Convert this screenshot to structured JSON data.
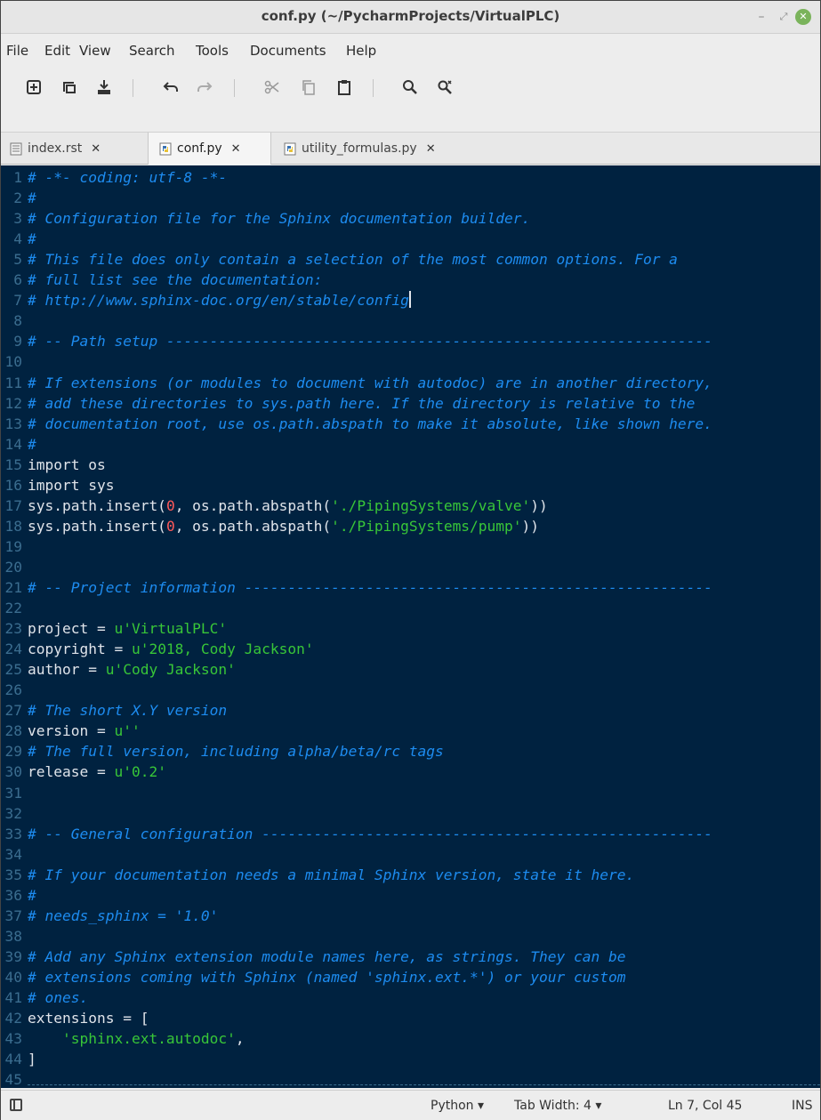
{
  "window": {
    "title": "conf.py (~/PycharmProjects/VirtualPLC)"
  },
  "menu": [
    "File",
    "Edit",
    "View",
    "Search",
    "Tools",
    "Documents",
    "Help"
  ],
  "tabs": [
    {
      "label": "index.rst",
      "icon": "text-file-icon",
      "active": false
    },
    {
      "label": "conf.py",
      "icon": "python-file-icon",
      "active": true
    },
    {
      "label": "utility_formulas.py",
      "icon": "python-file-icon",
      "active": false
    }
  ],
  "code": [
    [
      [
        "cm",
        "# -*- coding: utf-8 -*-"
      ]
    ],
    [
      [
        "cm",
        "#"
      ]
    ],
    [
      [
        "cm",
        "# Configuration file for the Sphinx documentation builder."
      ]
    ],
    [
      [
        "cm",
        "#"
      ]
    ],
    [
      [
        "cm",
        "# This file does only contain a selection of the most common options. For a"
      ]
    ],
    [
      [
        "cm",
        "# full list see the documentation:"
      ]
    ],
    [
      [
        "cm",
        "# http://www.sphinx-doc.org/en/stable/config"
      ],
      [
        "cursor",
        ""
      ]
    ],
    [],
    [
      [
        "cm",
        "# -- Path setup ---------------------------------------------------------------"
      ]
    ],
    [],
    [
      [
        "cm",
        "# If extensions (or modules to document with autodoc) are in another directory,"
      ]
    ],
    [
      [
        "cm",
        "# add these directories to sys.path here. If the directory is relative to the"
      ]
    ],
    [
      [
        "cm",
        "# documentation root, use os.path.abspath to make it absolute, like shown here."
      ]
    ],
    [
      [
        "cm",
        "#"
      ]
    ],
    [
      [
        "nm",
        "import os"
      ]
    ],
    [
      [
        "nm",
        "import sys"
      ]
    ],
    [
      [
        "nm",
        "sys.path.insert("
      ],
      [
        "num",
        "0"
      ],
      [
        "nm",
        ", os.path.abspath("
      ],
      [
        "st",
        "'./PipingSystems/valve'"
      ],
      [
        "nm",
        "))"
      ]
    ],
    [
      [
        "nm",
        "sys.path.insert("
      ],
      [
        "num",
        "0"
      ],
      [
        "nm",
        ", os.path.abspath("
      ],
      [
        "st",
        "'./PipingSystems/pump'"
      ],
      [
        "nm",
        "))"
      ]
    ],
    [],
    [],
    [
      [
        "cm",
        "# -- Project information ------------------------------------------------------"
      ]
    ],
    [],
    [
      [
        "nm",
        "project = "
      ],
      [
        "st",
        "u'VirtualPLC'"
      ]
    ],
    [
      [
        "nm",
        "copyright = "
      ],
      [
        "st",
        "u'2018, Cody Jackson'"
      ]
    ],
    [
      [
        "nm",
        "author = "
      ],
      [
        "st",
        "u'Cody Jackson'"
      ]
    ],
    [],
    [
      [
        "cm",
        "# The short X.Y version"
      ]
    ],
    [
      [
        "nm",
        "version = "
      ],
      [
        "st",
        "u''"
      ]
    ],
    [
      [
        "cm",
        "# The full version, including alpha/beta/rc tags"
      ]
    ],
    [
      [
        "nm",
        "release = "
      ],
      [
        "st",
        "u'0.2'"
      ]
    ],
    [],
    [],
    [
      [
        "cm",
        "# -- General configuration ----------------------------------------------------"
      ]
    ],
    [],
    [
      [
        "cm",
        "# If your documentation needs a minimal Sphinx version, state it here."
      ]
    ],
    [
      [
        "cm",
        "#"
      ]
    ],
    [
      [
        "cm",
        "# needs_sphinx = '1.0'"
      ]
    ],
    [],
    [
      [
        "cm",
        "# Add any Sphinx extension module names here, as strings. They can be"
      ]
    ],
    [
      [
        "cm",
        "# extensions coming with Sphinx (named 'sphinx.ext.*') or your custom"
      ]
    ],
    [
      [
        "cm",
        "# ones."
      ]
    ],
    [
      [
        "nm",
        "extensions = ["
      ]
    ],
    [
      [
        "nm",
        "    "
      ],
      [
        "st",
        "'sphinx.ext.autodoc'"
      ],
      [
        "nm",
        ","
      ]
    ],
    [
      [
        "nm",
        "]"
      ]
    ],
    []
  ],
  "status": {
    "language": "Python",
    "tab_width": "Tab Width: 4",
    "position": "Ln 7, Col 45",
    "mode": "INS"
  },
  "colors": {
    "editor_bg": "#002240",
    "comment": "#1d8cf0",
    "string": "#38c638",
    "number": "#ff5a5a",
    "line_number": "#3b6d8f"
  }
}
